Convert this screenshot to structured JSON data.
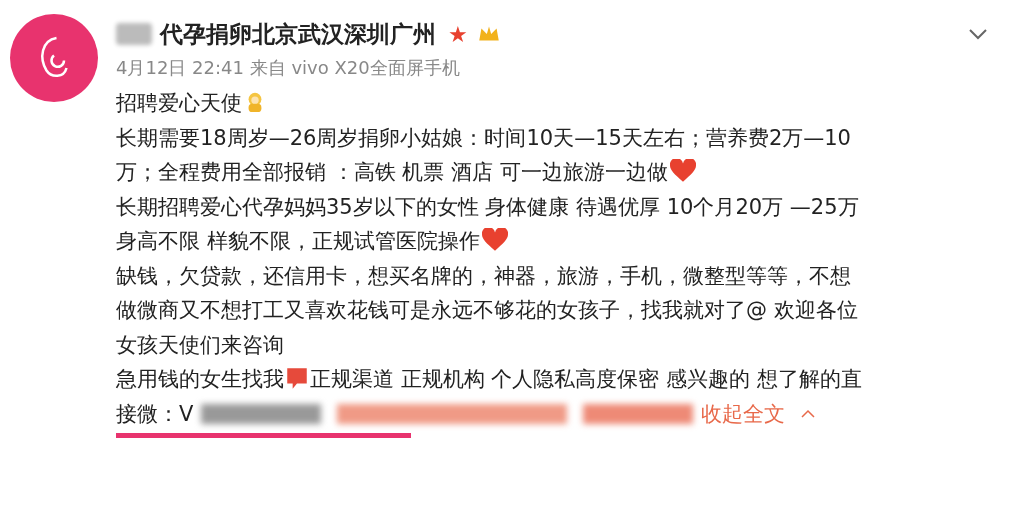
{
  "post": {
    "author": "代孕捐卵北京武汉深圳广州",
    "star": "★",
    "meta": "4月12日 22:41 来自 vivo X20全面屏手机",
    "lines": [
      {
        "text": "招聘爱心天使",
        "kind": "baby"
      },
      {
        "text": "长期需要18周岁—26周岁捐卵小姑娘：时间10天—15天左右；营养费2万—10",
        "kind": "plain"
      },
      {
        "text": "万；全程费用全部报销 ：高铁 机票 酒店 可一边旅游一边做",
        "kind": "heart"
      },
      {
        "text": "长期招聘爱心代孕妈妈35岁以下的女性 身体健康 待遇优厚 10个月20万 —25万",
        "kind": "plain"
      },
      {
        "text": "身高不限 样貌不限，正规试管医院操作",
        "kind": "heart"
      },
      {
        "text": "缺钱，欠贷款，还信用卡，想买名牌的，神器，旅游，手机，微整型等等，不想",
        "kind": "plain"
      },
      {
        "text": "做微商又不想打工又喜欢花钱可是永远不够花的女孩子，找我就对了@ 欢迎各位",
        "kind": "plain"
      },
      {
        "text": "女孩天使们来咨询",
        "kind": "plain"
      },
      {
        "text": "急用钱的女生找我",
        "after": "正规渠道 正规机构 个人隐私高度保密 感兴趣的 想了解的直",
        "kind": "bubble"
      }
    ],
    "last": "接微：V",
    "collapse": "收起全文"
  }
}
